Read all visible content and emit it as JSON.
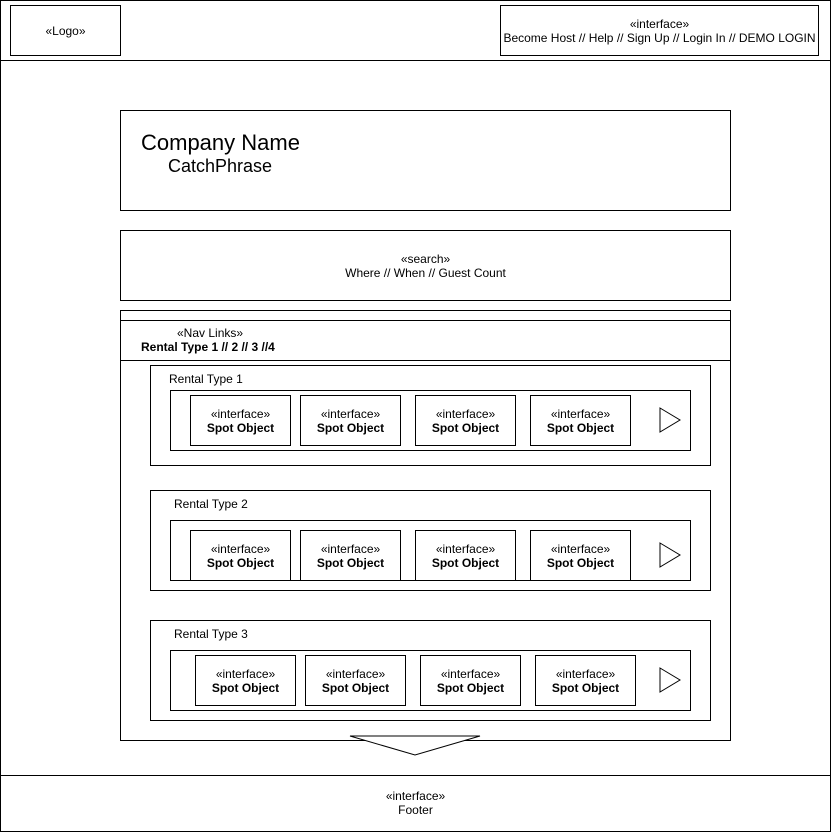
{
  "header": {
    "logo": "«Logo»",
    "nav_stereotype": "«interface»",
    "nav_links": "Become Host // Help // Sign Up // Login In // DEMO LOGIN"
  },
  "hero": {
    "company_name": "Company Name",
    "catchphrase": "CatchPhrase"
  },
  "search": {
    "stereotype": "«search»",
    "fields": "Where // When // Guest Count"
  },
  "nav_links": {
    "stereotype": "«Nav Links»",
    "items": "Rental Type 1 // 2 // 3  //4"
  },
  "sections": [
    {
      "title": "Rental Type 1",
      "spots": [
        {
          "stereotype": "«interface»",
          "label": "Spot Object"
        },
        {
          "stereotype": "«interface»",
          "label": "Spot Object"
        },
        {
          "stereotype": "«interface»",
          "label": "Spot Object"
        },
        {
          "stereotype": "«interface»",
          "label": "Spot Object"
        }
      ]
    },
    {
      "title": "Rental Type 2",
      "spots": [
        {
          "stereotype": "«interface»",
          "label": "Spot Object"
        },
        {
          "stereotype": "«interface»",
          "label": "Spot Object"
        },
        {
          "stereotype": "«interface»",
          "label": "Spot Object"
        },
        {
          "stereotype": "«interface»",
          "label": "Spot Object"
        }
      ]
    },
    {
      "title": "Rental Type 3",
      "spots": [
        {
          "stereotype": "«interface»",
          "label": "Spot Object"
        },
        {
          "stereotype": "«interface»",
          "label": "Spot Object"
        },
        {
          "stereotype": "«interface»",
          "label": "Spot Object"
        },
        {
          "stereotype": "«interface»",
          "label": "Spot Object"
        }
      ]
    }
  ],
  "footer": {
    "stereotype": "«interface»",
    "label": "Footer"
  }
}
